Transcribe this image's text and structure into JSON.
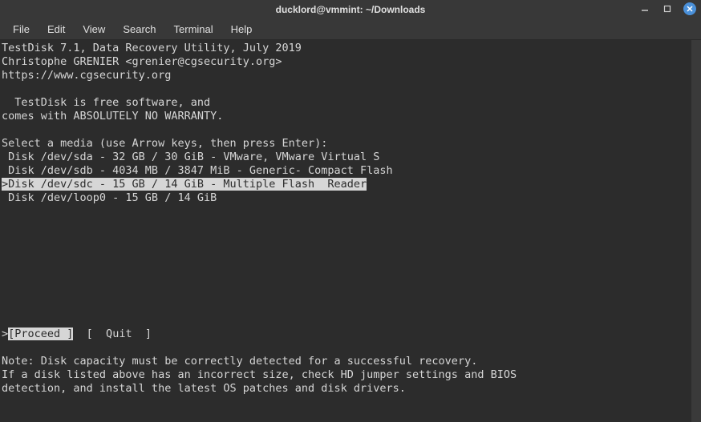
{
  "window": {
    "title": "ducklord@vmmint: ~/Downloads"
  },
  "menubar": {
    "items": [
      "File",
      "Edit",
      "View",
      "Search",
      "Terminal",
      "Help"
    ]
  },
  "terminal": {
    "header1": "TestDisk 7.1, Data Recovery Utility, July 2019",
    "header2": "Christophe GRENIER <grenier@cgsecurity.org>",
    "header3": "https://www.cgsecurity.org",
    "blank": "",
    "free1": "  TestDisk is free software, and",
    "free2": "comes with ABSOLUTELY NO WARRANTY.",
    "select_prompt": "Select a media (use Arrow keys, then press Enter):",
    "disks": [
      " Disk /dev/sda - 32 GB / 30 GiB - VMware, VMware Virtual S",
      " Disk /dev/sdb - 4034 MB / 3847 MiB - Generic- Compact Flash",
      ">Disk /dev/sdc - 15 GB / 14 GiB - Multiple Flash  Reader",
      " Disk /dev/loop0 - 15 GB / 14 GiB"
    ],
    "selected_index": 2,
    "options_line_prefix": ">",
    "option_proceed": "[Proceed ]",
    "option_quit": "  [  Quit  ]",
    "note1": "Note: Disk capacity must be correctly detected for a successful recovery.",
    "note2": "If a disk listed above has an incorrect size, check HD jumper settings and BIOS",
    "note3": "detection, and install the latest OS patches and disk drivers."
  }
}
